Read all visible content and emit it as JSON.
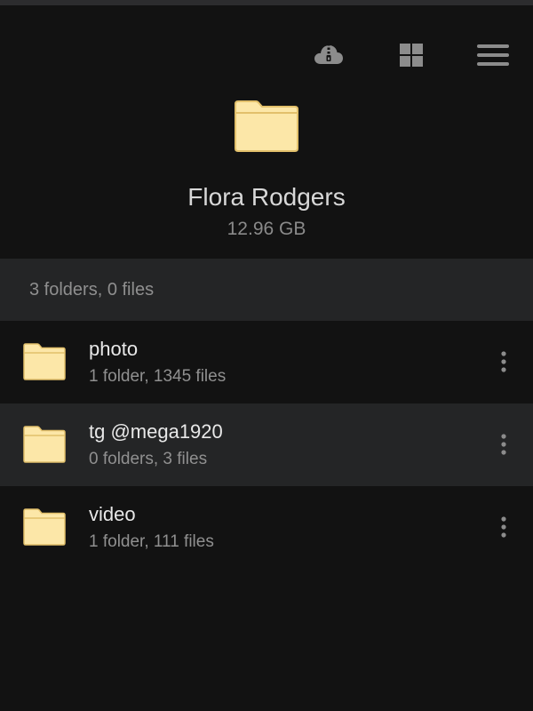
{
  "header": {
    "icons": [
      "cloud-zip-icon",
      "grid-view-icon",
      "menu-icon"
    ]
  },
  "hero": {
    "title": "Flora Rodgers",
    "size": "12.96 GB",
    "icon": "folder-icon"
  },
  "summary": {
    "text": "3 folders, 0 files"
  },
  "items": [
    {
      "name": "photo",
      "meta": "1 folder, 1345 files",
      "icon": "folder-icon"
    },
    {
      "name": "tg @mega1920",
      "meta": "0 folders, 3 files",
      "icon": "folder-icon"
    },
    {
      "name": "video",
      "meta": "1 folder, 111 files",
      "icon": "folder-icon"
    }
  ],
  "colors": {
    "background": "#121212",
    "bar": "#242526",
    "folder_fill": "#fce7a8",
    "folder_stroke": "#e2c06b",
    "icon_gray": "#8c8c8c"
  }
}
